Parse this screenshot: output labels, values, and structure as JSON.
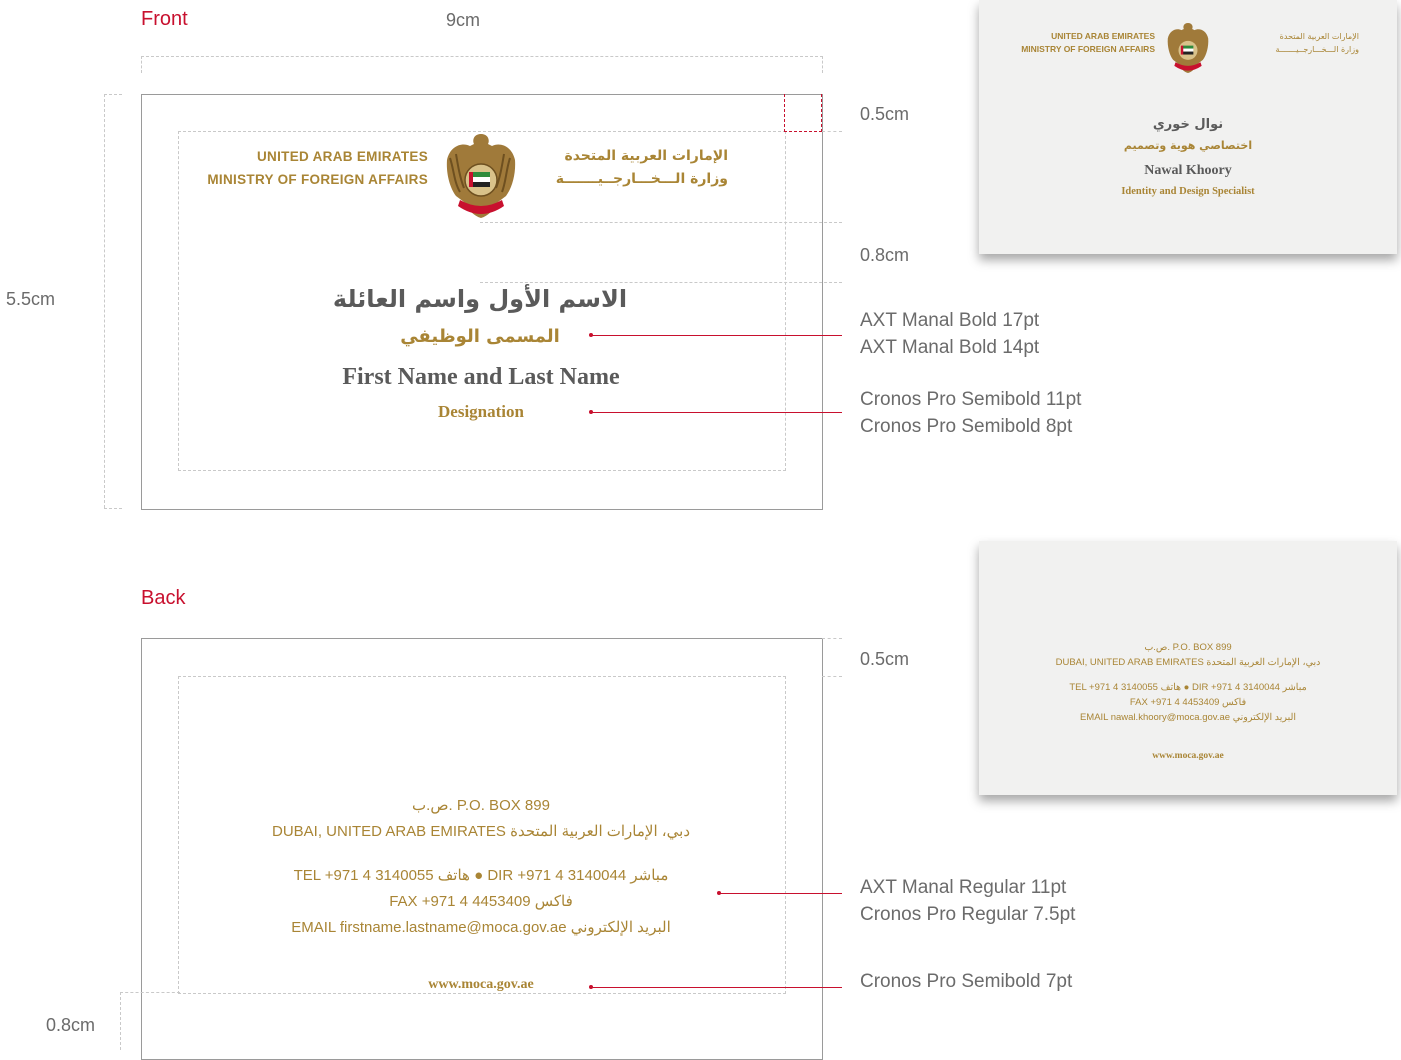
{
  "labels": {
    "front": "Front",
    "back": "Back"
  },
  "dimensions": {
    "width": "9cm",
    "height": "5.5cm",
    "front_top_margin": "0.5cm",
    "front_gap": "0.8cm",
    "back_top_margin": "0.5cm",
    "back_bottom_margin": "0.8cm"
  },
  "front_card": {
    "brand_en_line1": "UNITED ARAB EMIRATES",
    "brand_en_line2": "MINISTRY OF FOREIGN AFFAIRS",
    "brand_ar_line1": "الإمارات العربية المتحدة",
    "brand_ar_line2": "وزارة الـــخـــارجــيـــــــة",
    "name_ar": "الاسم الأول واسم العائلة",
    "title_ar": "المسمى الوظيفي",
    "name_en": "First Name and Last Name",
    "title_en": "Designation",
    "emblem": "uae-emblem-icon"
  },
  "front_specs": {
    "line1": "AXT Manal Bold 17pt",
    "line2": "AXT Manal Bold 14pt",
    "line3": "Cronos Pro Semibold 11pt",
    "line4": "Cronos Pro Semibold 8pt"
  },
  "front_sample": {
    "brand_en_line1": "UNITED ARAB EMIRATES",
    "brand_en_line2": "MINISTRY OF FOREIGN AFFAIRS",
    "brand_ar_line1": "الإمارات العربية المتحدة",
    "brand_ar_line2": "وزارة الـــخـــارجــيـــــــة",
    "name_ar": "نوال خوري",
    "title_ar": "اختصاصي هوية وتصميم",
    "name_en": "Nawal Khoory",
    "title_en": "Identity and Design Specialist"
  },
  "back_card": {
    "po_box": "ص.ب. P.O. BOX 899",
    "city": "DUBAI, UNITED ARAB EMIRATES دبي، الإمارات العربية المتحدة",
    "tel": "TEL +971 4 3140055 هاتف ● DIR +971 4 3140044 مباشر",
    "fax": "FAX +971 4 4453409 فاكس",
    "email": "EMAIL firstname.lastname@moca.gov.ae البريد الإلكتروني",
    "web": "www.moca.gov.ae"
  },
  "back_specs": {
    "line1": "AXT Manal Regular 11pt",
    "line2": "Cronos Pro Regular 7.5pt",
    "line3": "Cronos Pro Semibold 7pt"
  },
  "back_sample": {
    "po_box": "ص.ب. P.O. BOX 899",
    "city": "DUBAI, UNITED ARAB EMIRATES دبي، الإمارات العربية المتحدة",
    "tel": "TEL +971 4 3140055 هاتف ● DIR +971 4 3140044 مباشر",
    "fax": "FAX +971 4 4453409 فاكس",
    "email": "EMAIL nawal.khoory@moca.gov.ae البريد الإلكتروني",
    "web": "www.moca.gov.ae"
  },
  "colors": {
    "accent_red": "#c8102e",
    "gold": "#a98535",
    "text_grey": "#5a5a5a"
  }
}
